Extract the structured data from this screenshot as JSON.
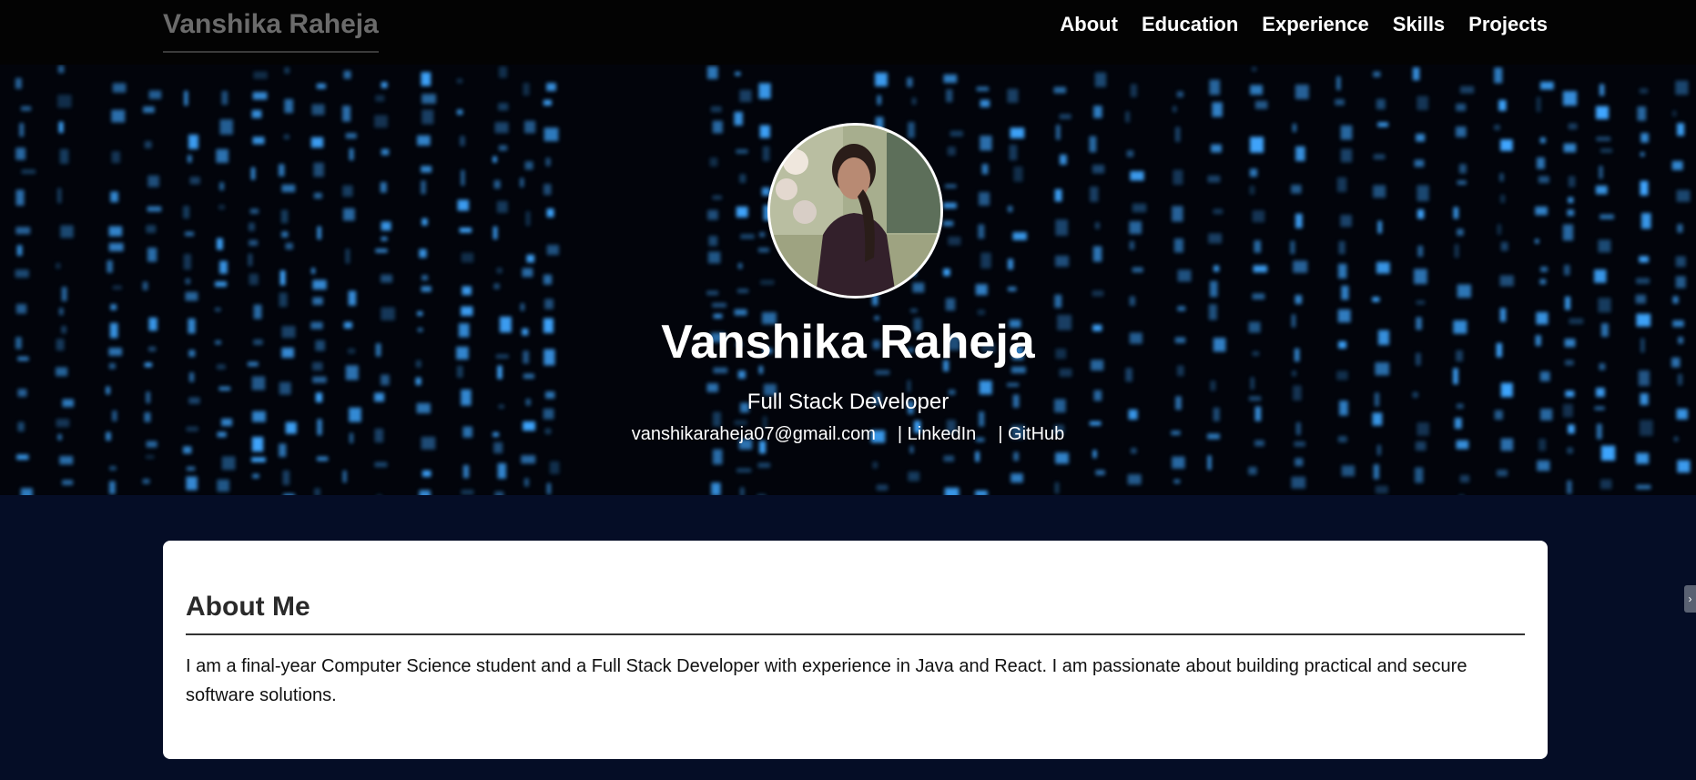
{
  "nav": {
    "brand": "Vanshika Raheja",
    "links": [
      "About",
      "Education",
      "Experience",
      "Skills",
      "Projects"
    ]
  },
  "hero": {
    "name": "Vanshika Raheja",
    "role": "Full Stack Developer",
    "email": "vanshikaraheja07@gmail.com",
    "linkedin": "| LinkedIn",
    "github": "| GitHub"
  },
  "about": {
    "title": "About Me",
    "text": "I am a final-year Computer Science student and a Full Stack Developer with experience in Java and React. I am passionate about building practical and secure software solutions."
  },
  "side_toggle": {
    "icon": "chevron-right-icon"
  },
  "colors": {
    "nav_bg": "#030303",
    "brand_text": "#6b6b6b",
    "page_bg": "#050d26",
    "matrix_glyph": "#3fa6ff",
    "card_bg": "#ffffff"
  }
}
